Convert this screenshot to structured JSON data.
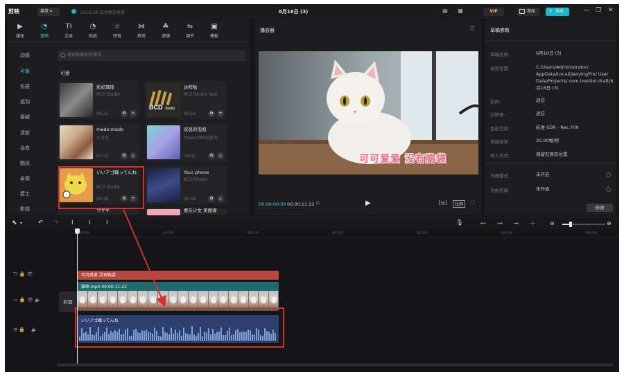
{
  "titlebar": {
    "logo": "剪映",
    "menu_label": "菜单",
    "save_status": "10:54:19 自动保存本地",
    "doc_title": "6月16日 (3)",
    "vip_label": "VIP",
    "review_label": "审阅",
    "export_label": "导出"
  },
  "tabs": [
    {
      "label": "媒体",
      "icon": "media-icon"
    },
    {
      "label": "音频",
      "icon": "audio-icon"
    },
    {
      "label": "文本",
      "icon": "text-icon"
    },
    {
      "label": "贴纸",
      "icon": "sticker-icon"
    },
    {
      "label": "特效",
      "icon": "effects-icon"
    },
    {
      "label": "转场",
      "icon": "transition-icon"
    },
    {
      "label": "滤镜",
      "icon": "filter-icon"
    },
    {
      "label": "调节",
      "icon": "adjust-icon"
    },
    {
      "label": "模板",
      "icon": "template-icon"
    }
  ],
  "active_tab": "音频",
  "categories": [
    "动感",
    "可爱",
    "伤感",
    "运动",
    "悬疑",
    "清新",
    "治愈",
    "酷炫",
    "亲情",
    "爵士",
    "影视"
  ],
  "active_category": "可爱",
  "search": {
    "placeholder": "搜索歌曲名称/歌手"
  },
  "section_title": "可爱",
  "tracks": [
    {
      "name": "彩虹璃瑶",
      "artist": "BCD Studio",
      "duration": "00:31"
    },
    {
      "name": "达咩啦",
      "artist": "BCD Studio Sepi",
      "duration": "00:24"
    },
    {
      "name": "medo:medo",
      "artist": "たきる",
      "duration": "01:22"
    },
    {
      "name": "叹息的泡泡",
      "artist": "Trove-Fifth创造力",
      "duration": "04:01"
    },
    {
      "name": "いいアゴ職ってんね",
      "artist": "BCD Studio",
      "duration": "00:28"
    },
    {
      "name": "Your phone",
      "artist": "BCD Studio",
      "duration": "00:43"
    },
    {
      "name": "ウサギ",
      "artist": "",
      "duration": ""
    },
    {
      "name": "要乐少女 美丽源",
      "artist": "",
      "duration": ""
    }
  ],
  "player": {
    "title": "播放器",
    "caption": "可可爱爱 没有脑袋",
    "current_time": "00:00:00:00",
    "total_time": "00:00:11:22",
    "ratio_label": "比例"
  },
  "params": {
    "title": "草稿参数",
    "rows": [
      {
        "label": "草稿名称:",
        "value": "6月16日 (3)"
      },
      {
        "label": "保存位置:",
        "value": "C:/Users/Administrator/ AppData/Local/JianyingPro/ User Data/Projects/ com.lveditor.draft/6月16日 (3)"
      },
      {
        "label": "比例:",
        "value": "适应"
      },
      {
        "label": "分辨率:",
        "value": "适应"
      },
      {
        "label": "色彩空间:",
        "value": "标准 SDR - Rec.709"
      },
      {
        "label": "草稿帧率:",
        "value": "30.00帧/秒"
      },
      {
        "label": "导入方式:",
        "value": "保留在原有位置"
      },
      {
        "label": "代理模式",
        "value": "未开启"
      },
      {
        "label": "自由层级:",
        "value": "未开启"
      }
    ],
    "modify_label": "修改"
  },
  "ruler_labels": [
    "00:00",
    "00:05",
    "00:10",
    "00:15",
    "00:20",
    "00:25",
    "00:30"
  ],
  "timeline": {
    "cover_label": "封面",
    "text_clip": "可可爱爱 没有脑袋",
    "video_clip": "猫咪.mp4  00:00:11:22",
    "audio_clip": "いいアゴ職ってんね"
  },
  "colors": {
    "accent": "#3fd3e6",
    "highlight": "#d0342c",
    "export": "#16b7c9"
  }
}
